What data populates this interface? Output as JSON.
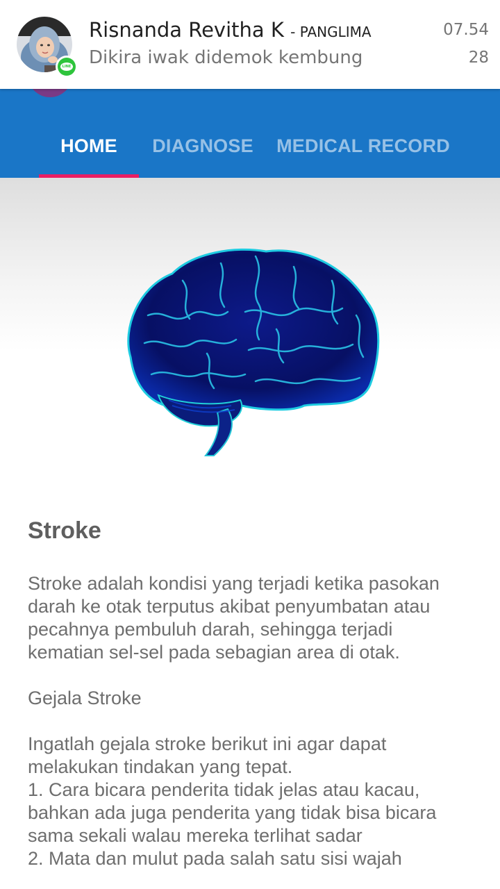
{
  "notification": {
    "sender": "Risnanda Revitha K",
    "group": "- PANGLIMA",
    "message": "Dikira iwak didemok kembung",
    "time": "07.54",
    "count": "28",
    "app_icon": "line-icon",
    "accent_color": "#2ec43c"
  },
  "appbar": {
    "color": "#1a76c7",
    "tabs": [
      {
        "label": "HOME",
        "active": true
      },
      {
        "label": "DIAGNOSE",
        "active": false
      },
      {
        "label": "MEDICAL RECORD",
        "active": false
      }
    ],
    "indicator_color": "#e91e63"
  },
  "article": {
    "image": "brain-illustration",
    "title": "Stroke",
    "paragraph1": "Stroke adalah kondisi yang terjadi ketika pasokan darah ke otak terputus akibat penyumbatan atau pecahnya pembuluh darah, sehingga terjadi kematian sel-sel pada sebagian area di otak.",
    "subheading": "Gejala Stroke",
    "intro": "Ingatlah gejala stroke berikut ini agar dapat melakukan tindakan yang tepat.",
    "symptom1": "1. Cara bicara penderita tidak jelas atau kacau, bahkan ada juga penderita yang tidak bisa bicara sama sekali walau mereka terlihat sadar",
    "symptom2": "2. Mata dan mulut pada salah satu sisi wajah"
  }
}
